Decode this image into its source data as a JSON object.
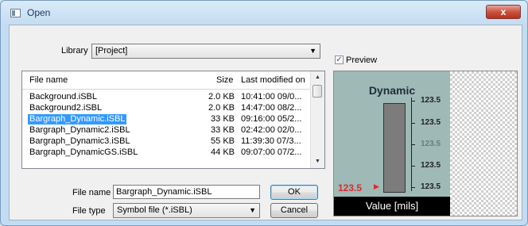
{
  "window": {
    "title": "Open",
    "close_glyph": "x"
  },
  "library": {
    "label": "Library",
    "value": "[Project]"
  },
  "preview_toggle": {
    "label": "Preview",
    "checked": true
  },
  "file_list": {
    "columns": [
      "File name",
      "Size",
      "Last modified on"
    ],
    "rows": [
      {
        "name": "Background.iSBL",
        "size": "2.0 KB",
        "modified": "10:41:00 09/0..."
      },
      {
        "name": "Background2.iSBL",
        "size": "2.0 KB",
        "modified": "14:47:00 08/2..."
      },
      {
        "name": "Bargraph_Dynamic.iSBL",
        "size": "33 KB",
        "modified": "09:16:00 05/2...",
        "selected": true
      },
      {
        "name": "Bargraph_Dynamic2.iSBL",
        "size": "33 KB",
        "modified": "02:42:00 02/0..."
      },
      {
        "name": "Bargraph_Dynamic3.iSBL",
        "size": "55 KB",
        "modified": "11:39:30 07/3..."
      },
      {
        "name": "Bargraph_DynamicGS.iSBL",
        "size": "44 KB",
        "modified": "09:07:00 07/2..."
      }
    ]
  },
  "file_name": {
    "label": "File name",
    "value": "Bargraph_Dynamic.iSBL"
  },
  "file_type": {
    "label": "File type",
    "value": "Symbol file (*.iSBL)"
  },
  "buttons": {
    "ok": "OK",
    "cancel": "Cancel"
  },
  "preview": {
    "title": "Dynamic",
    "scale_labels": [
      "123.5",
      "123.5",
      "123.5",
      "123.5",
      "123.5"
    ],
    "current_value": "123.5",
    "footer": "Value  [mils]",
    "value_color": "#e0282f"
  }
}
